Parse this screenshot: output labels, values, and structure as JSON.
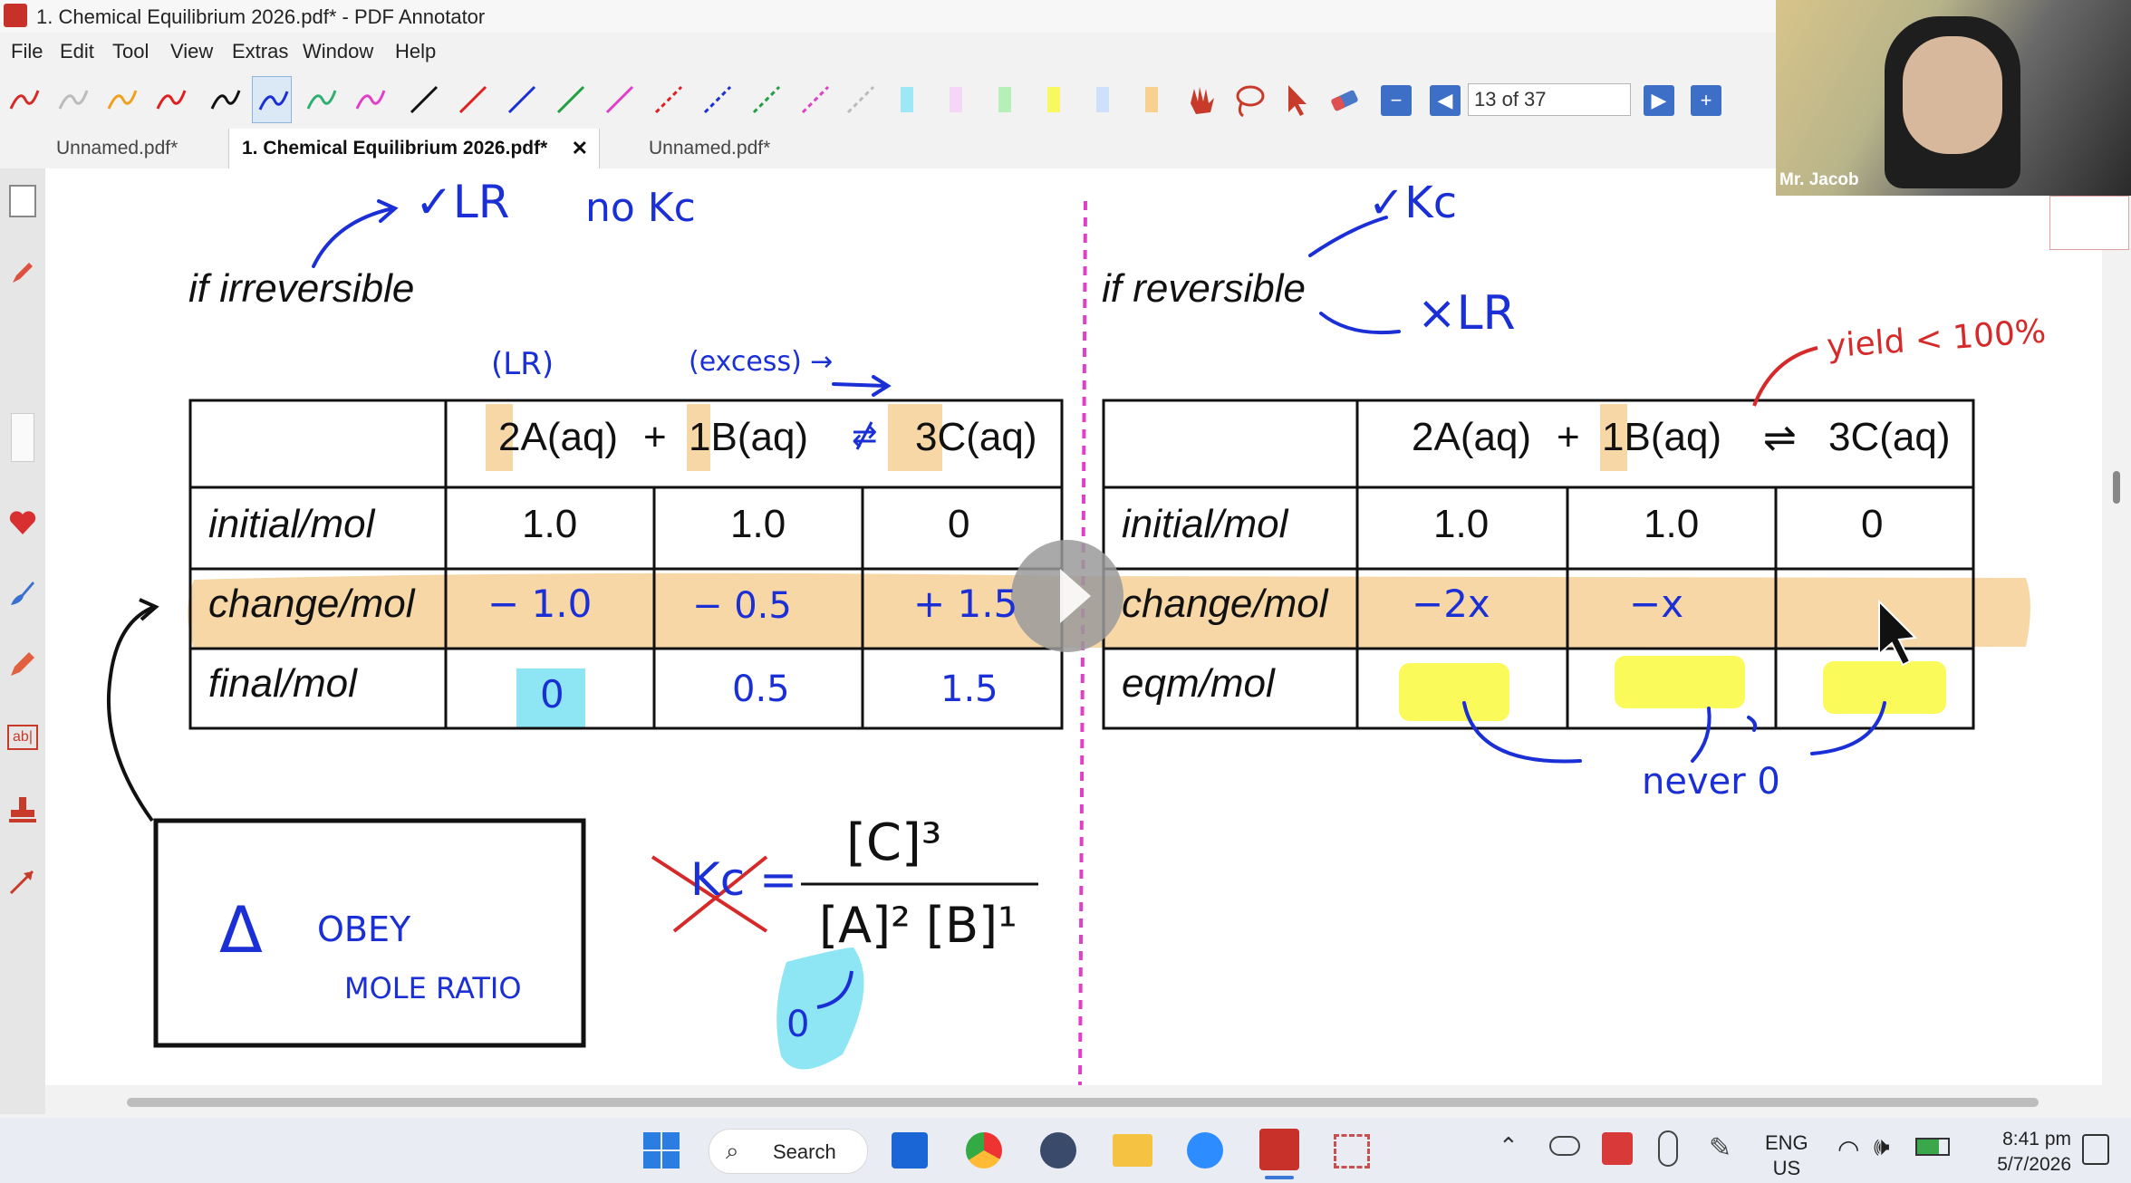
{
  "window": {
    "title": "1. Chemical Equilibrium 2026.pdf* - PDF Annotator"
  },
  "menu": [
    "File",
    "Edit",
    "Tool",
    "View",
    "Extras",
    "Window",
    "Help"
  ],
  "toolbar": {
    "page_field": "13 of 37"
  },
  "tabs": [
    {
      "label": "Unnamed.pdf*"
    },
    {
      "label": "1. Chemical Equilibrium 2026.pdf*",
      "close": "✕"
    },
    {
      "label": "Unnamed.pdf*"
    }
  ],
  "webcam": {
    "name": "Mr. Jacob"
  },
  "slide": {
    "left_heading": "if irreversible",
    "right_heading": "if reversible",
    "left_table": {
      "equation": {
        "a": "2A(aq)",
        "plus": "+",
        "b": "1B(aq)",
        "c": "3C(aq)"
      },
      "rows": [
        {
          "label": "initial/mol",
          "values": [
            "1.0",
            "1.0",
            "0"
          ]
        },
        {
          "label": "change/mol",
          "values": [
            "",
            "",
            ""
          ]
        },
        {
          "label": "final/mol",
          "values": [
            "",
            "",
            ""
          ]
        }
      ]
    },
    "right_table": {
      "equation": {
        "a": "2A(aq)",
        "plus": "+",
        "b": "1B(aq)",
        "arrow": "⇌",
        "c": "3C(aq)"
      },
      "rows": [
        {
          "label": "initial/mol",
          "values": [
            "1.0",
            "1.0",
            "0"
          ]
        },
        {
          "label": "change/mol",
          "values": [
            "",
            "",
            ""
          ]
        },
        {
          "label": "eqm/mol",
          "values": [
            "",
            "",
            ""
          ]
        }
      ]
    },
    "annotations": {
      "lr_check": "✓LR",
      "no_kc": "no Kc",
      "kc_check": "✓Kc",
      "x_lr": "×LR",
      "lr_label": "(LR)",
      "excess_label": "(excess) →",
      "yield": "yield < 100%",
      "change_left": [
        "− 1.0",
        "− 0.5",
        "+ 1.5"
      ],
      "final_left": [
        "0",
        "0.5",
        "1.5"
      ],
      "change_right": [
        "−2x",
        "−x"
      ],
      "never_zero": "never 0",
      "box_delta": "Δ",
      "box_obey": "OBEY",
      "box_mole_ratio": "MOLE RATIO",
      "kc_numerator": "[C]³",
      "kc_denominator": "[A]² [B]¹",
      "kc_symbol": "Kc =",
      "zero_below": "0"
    }
  },
  "taskbar": {
    "search": "Search",
    "lang_top": "ENG",
    "lang_bottom": "US",
    "time": "8:41 pm",
    "date": "5/7/2026"
  },
  "colors": {
    "ink_blue": "#1a2fd6",
    "ink_red": "#d62a2a",
    "highlight_orange": "#f8d7a6",
    "highlight_yellow": "#fafa5a",
    "highlight_cyan": "#8ee6f4",
    "divider_magenta": "#e040c8"
  }
}
